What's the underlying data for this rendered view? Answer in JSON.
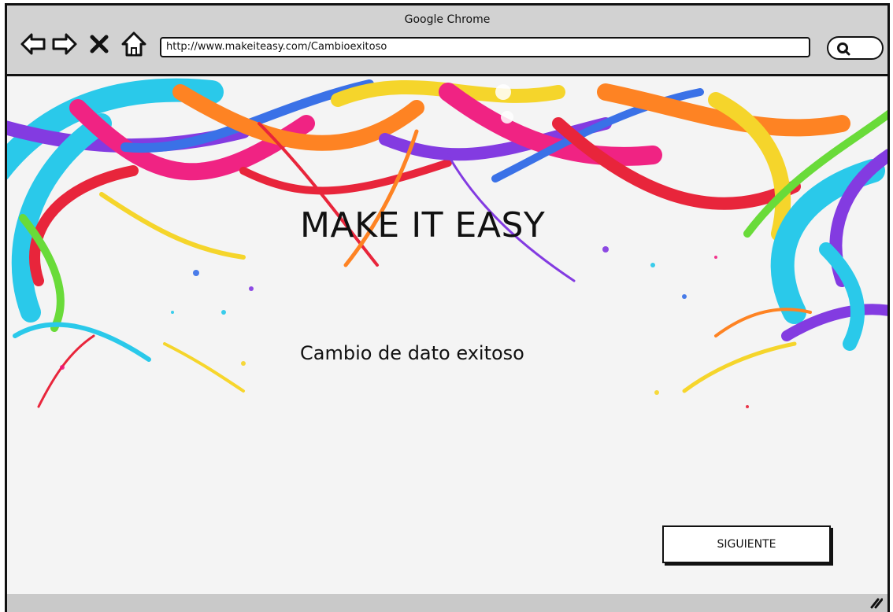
{
  "browser": {
    "title": "Google Chrome",
    "url": "http://www.makeiteasy.com/Cambioexitoso",
    "icons": [
      "back-arrow-icon",
      "forward-arrow-icon",
      "close-icon",
      "home-icon",
      "search-icon",
      "resize-grip-icon"
    ]
  },
  "page": {
    "headline": "MAKE IT EASY",
    "message": "Cambio de dato exitoso",
    "next_label": "SIGUIENTE"
  },
  "colors": {
    "chrome_gray": "#d2d2d2",
    "page_background": "#f4f4f4",
    "outline": "#111111",
    "splash_red": "#e8142c",
    "splash_magenta": "#f0127a",
    "splash_purple": "#7a2ce0",
    "splash_blue": "#2b66e6",
    "splash_cyan": "#19c6ea",
    "splash_yellow": "#f6d31a",
    "splash_orange": "#ff7a12",
    "splash_green": "#5ed92a"
  }
}
